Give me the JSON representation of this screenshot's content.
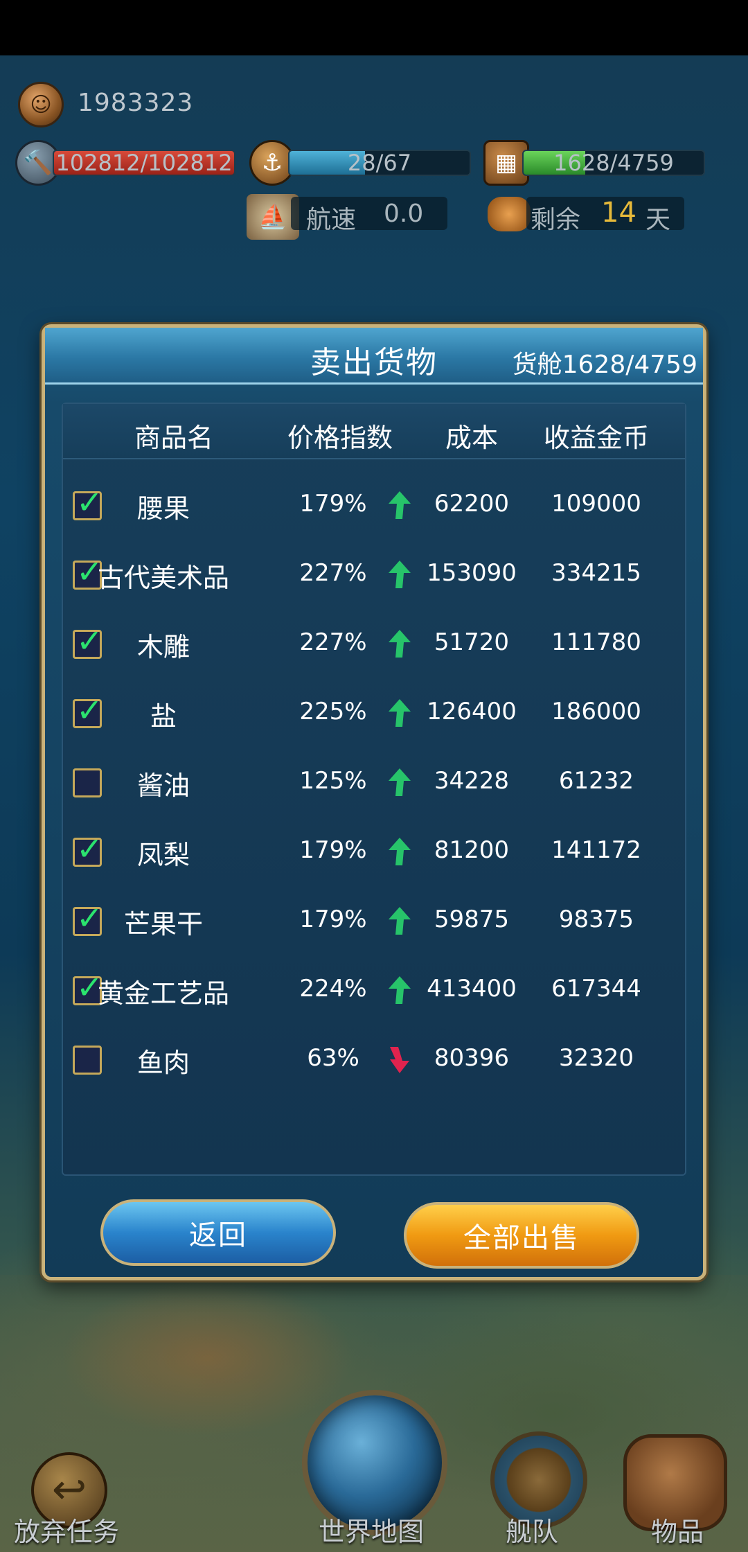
{
  "hud": {
    "gold": "1983323",
    "durability": "102812/102812",
    "crew": "28/67",
    "cargo": "1628/4759",
    "speed_label": "航速",
    "speed_value": "0.0",
    "supply_label": "剩余",
    "supply_days": "14",
    "supply_unit": "天"
  },
  "dialog": {
    "title": "卖出货物",
    "cargo_label": "货舱1628/4759",
    "columns": [
      "商品名",
      "价格指数",
      "成本",
      "收益金币"
    ],
    "rows": [
      {
        "checked": true,
        "name": "腰果",
        "index": "179%",
        "trend": "up",
        "cost": "62200",
        "revenue": "109000"
      },
      {
        "checked": true,
        "name": "古代美术品",
        "index": "227%",
        "trend": "up",
        "cost": "153090",
        "revenue": "334215"
      },
      {
        "checked": true,
        "name": "木雕",
        "index": "227%",
        "trend": "up",
        "cost": "51720",
        "revenue": "111780"
      },
      {
        "checked": true,
        "name": "盐",
        "index": "225%",
        "trend": "up",
        "cost": "126400",
        "revenue": "186000"
      },
      {
        "checked": false,
        "name": "酱油",
        "index": "125%",
        "trend": "up",
        "cost": "34228",
        "revenue": "61232"
      },
      {
        "checked": true,
        "name": "凤梨",
        "index": "179%",
        "trend": "up",
        "cost": "81200",
        "revenue": "141172"
      },
      {
        "checked": true,
        "name": "芒果干",
        "index": "179%",
        "trend": "up",
        "cost": "59875",
        "revenue": "98375"
      },
      {
        "checked": true,
        "name": "黄金工艺品",
        "index": "224%",
        "trend": "up",
        "cost": "413400",
        "revenue": "617344"
      },
      {
        "checked": false,
        "name": "鱼肉",
        "index": "63%",
        "trend": "down",
        "cost": "80396",
        "revenue": "32320"
      }
    ],
    "back_label": "返回",
    "sell_all_label": "全部出售"
  },
  "nav": {
    "abandon": "放弃任务",
    "world_map": "世界地图",
    "fleet": "舰队",
    "items": "物品"
  },
  "colors": {
    "check": "#2be36e",
    "arrow_up": "#27c46a",
    "arrow_down": "#e0234e",
    "frame_gold": "#c9b27a"
  }
}
